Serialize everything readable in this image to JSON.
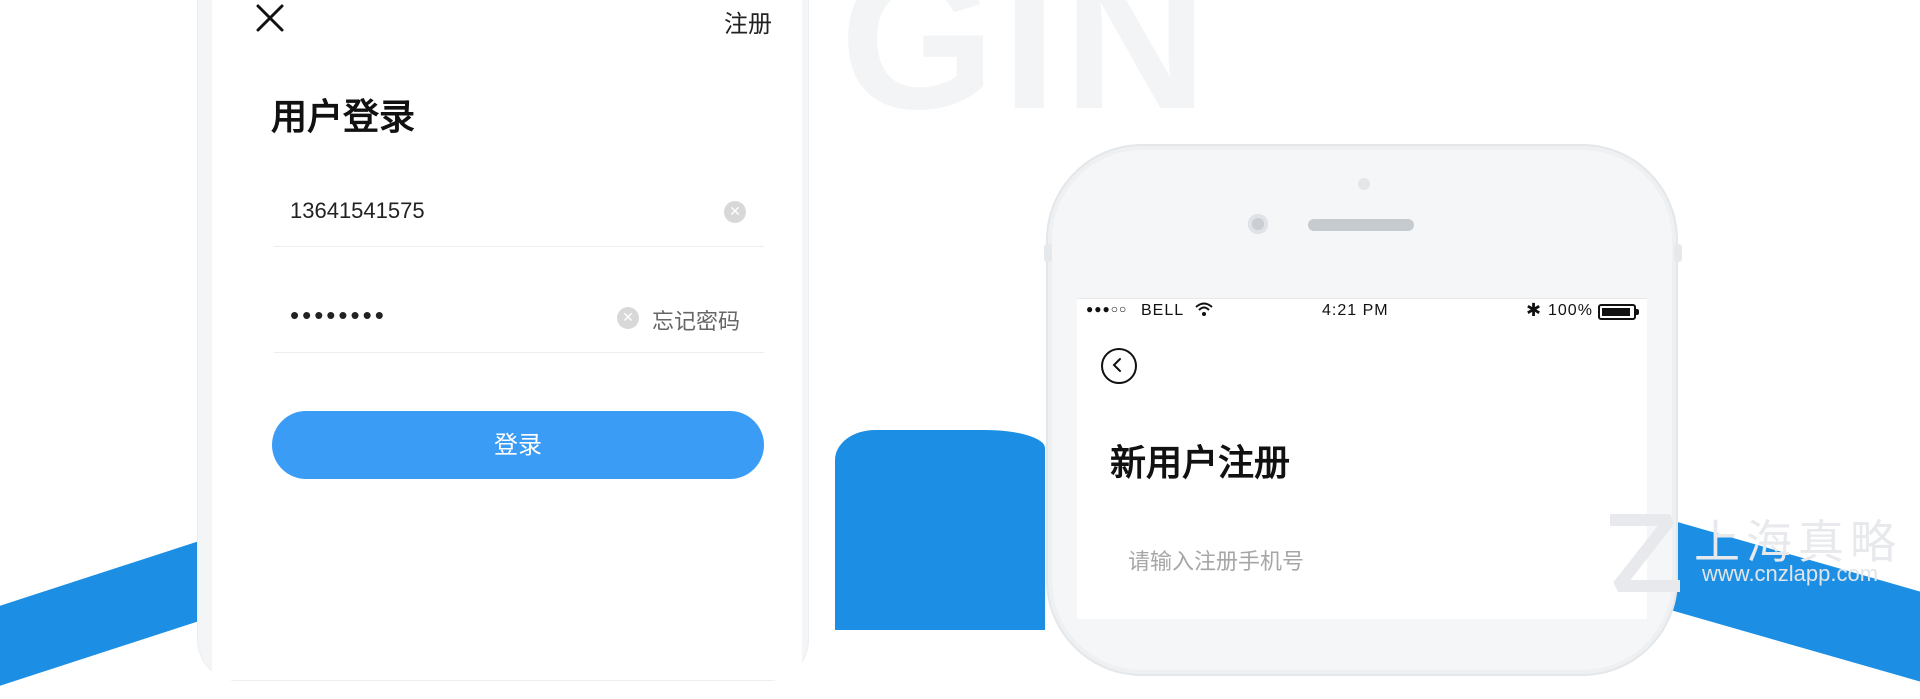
{
  "background": {
    "watermark_text": "GIN",
    "accent_color": "#1c8fe4"
  },
  "login_screen": {
    "close_icon": "close-icon",
    "register_link": "注册",
    "title": "用户登录",
    "phone_value": "13641541575",
    "password_value": "••••••••",
    "clear_icon": "clear-circle-icon",
    "forgot_link": "忘记密码",
    "login_button": "登录",
    "button_color": "#3b9cf6"
  },
  "register_screen": {
    "status_bar": {
      "signal": "●●●○○",
      "carrier": "BELL",
      "wifi_icon": "wifi-icon",
      "time": "4:21 PM",
      "bluetooth_icon": "✱",
      "battery_percent": "100%"
    },
    "back_icon": "back-icon",
    "title": "新用户注册",
    "phone_placeholder": "请输入注册手机号"
  },
  "watermark": {
    "brand": "上海真略",
    "url": "www.cnzlapp.com"
  }
}
